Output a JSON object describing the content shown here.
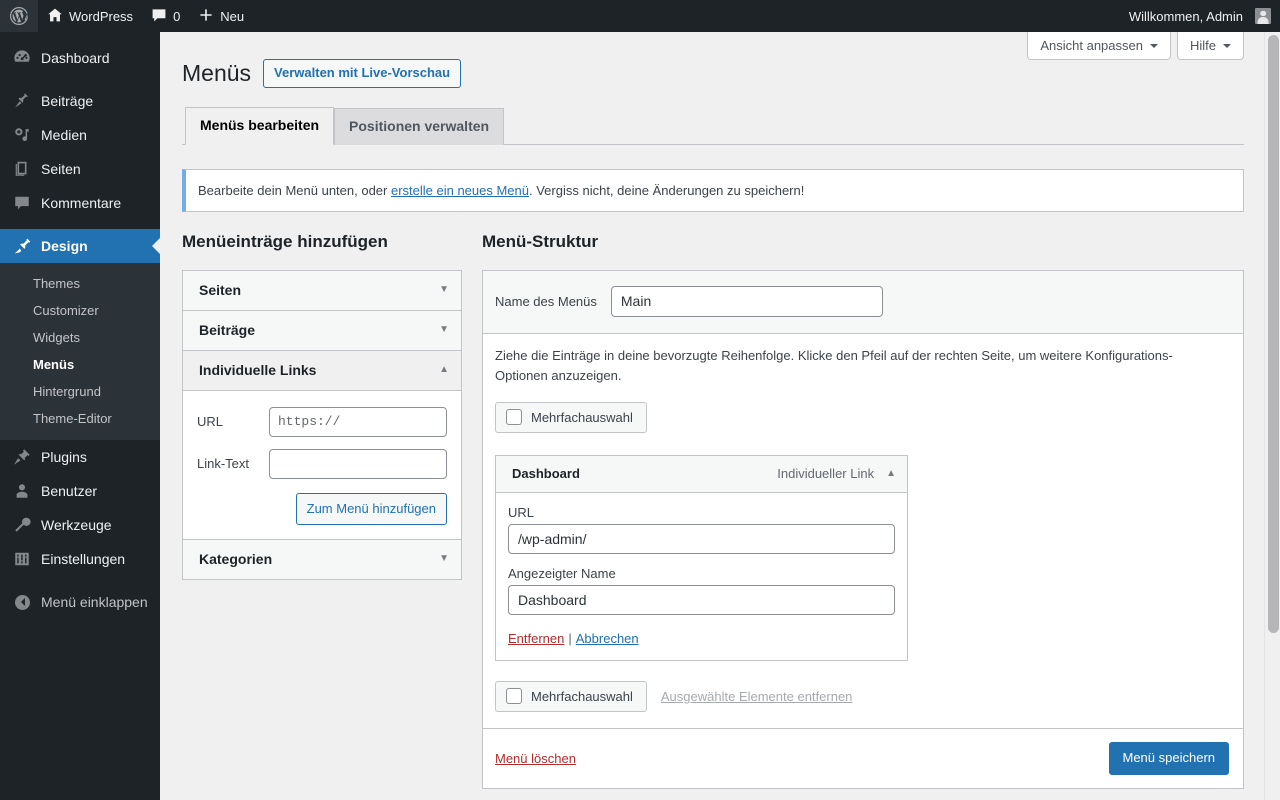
{
  "adminbar": {
    "logo_icon": "wordpress-logo-icon",
    "site_name": "WordPress",
    "site_icon": "home-icon",
    "comments_icon": "comment-bubble-icon",
    "comments_count": "0",
    "new_icon": "plus-icon",
    "new_label": "Neu",
    "greeting": "Willkommen, Admin",
    "avatar_icon": "avatar-icon"
  },
  "sidebar": {
    "items": [
      {
        "label": "Dashboard",
        "icon": "dashboard-icon"
      },
      {
        "label": "Beiträge",
        "icon": "pin-icon"
      },
      {
        "label": "Medien",
        "icon": "media-icon"
      },
      {
        "label": "Seiten",
        "icon": "pages-icon"
      },
      {
        "label": "Kommentare",
        "icon": "comment-icon"
      },
      {
        "label": "Design",
        "icon": "appearance-brush-icon"
      },
      {
        "label": "Plugins",
        "icon": "plugins-plug-icon"
      },
      {
        "label": "Benutzer",
        "icon": "users-icon"
      },
      {
        "label": "Werkzeuge",
        "icon": "tools-wrench-icon"
      },
      {
        "label": "Einstellungen",
        "icon": "settings-sliders-icon"
      }
    ],
    "submenu": [
      {
        "label": "Themes"
      },
      {
        "label": "Customizer"
      },
      {
        "label": "Widgets"
      },
      {
        "label": "Menüs"
      },
      {
        "label": "Hintergrund"
      },
      {
        "label": "Theme-Editor"
      }
    ],
    "collapse": {
      "label": "Menü einklappen",
      "icon": "collapse-arrow-icon"
    },
    "active_item": "Design",
    "active_subitem": "Menüs"
  },
  "screen_meta": {
    "options_label": "Ansicht anpassen",
    "help_label": "Hilfe"
  },
  "header": {
    "title": "Menüs",
    "live_preview_button": "Verwalten mit Live-Vorschau"
  },
  "tabs": [
    {
      "label": "Menüs bearbeiten",
      "active": true
    },
    {
      "label": "Positionen verwalten",
      "active": false
    }
  ],
  "notice": {
    "text_before": "Bearbeite dein Menü unten, oder ",
    "link": "erstelle ein neues Menü",
    "text_after": ". Vergiss nicht, deine Änderungen zu speichern!"
  },
  "add_items": {
    "title": "Menüeinträge hinzufügen",
    "accordions": [
      {
        "label": "Seiten",
        "open": false,
        "icon": "chevron-down-icon"
      },
      {
        "label": "Beiträge",
        "open": false,
        "icon": "chevron-down-icon"
      },
      {
        "label": "Individuelle Links",
        "open": true,
        "icon": "chevron-up-icon"
      },
      {
        "label": "Kategorien",
        "open": false,
        "icon": "chevron-down-icon"
      }
    ],
    "custom_link": {
      "url_label": "URL",
      "url_value": "",
      "url_placeholder": "https://",
      "text_label": "Link-Text",
      "text_value": "",
      "text_placeholder": "",
      "add_button": "Zum Menü hinzufügen"
    }
  },
  "structure": {
    "title": "Menü-Struktur",
    "name_label": "Name des Menüs",
    "name_value": "Main",
    "hint": "Ziehe die Einträge in deine bevorzugte Reihenfolge. Klicke den Pfeil auf der rechten Seite, um weitere Konfigurations-Optionen anzuzeigen.",
    "bulk_top_label": "Mehrfachauswahl",
    "bulk_bottom_label": "Mehrfachauswahl",
    "bulk_remove_label": "Ausgewählte Elemente entfernen",
    "menu_item": {
      "title": "Dashboard",
      "type": "Individueller Link",
      "toggle_icon": "chevron-up-icon",
      "url_label": "URL",
      "url_value": "/wp-admin/",
      "name_label": "Angezeigter Name",
      "name_value": "Dashboard",
      "remove_link": "Entfernen",
      "separator": "|",
      "cancel_link": "Abbrechen"
    },
    "delete_menu_label": "Menü löschen",
    "save_menu_label": "Menü speichern"
  },
  "colors": {
    "accent": "#2271b1",
    "sidebar_bg": "#1d2327",
    "submenu_bg": "#2c3338",
    "danger": "#b32d2e",
    "page_bg": "#f0f0f1"
  }
}
